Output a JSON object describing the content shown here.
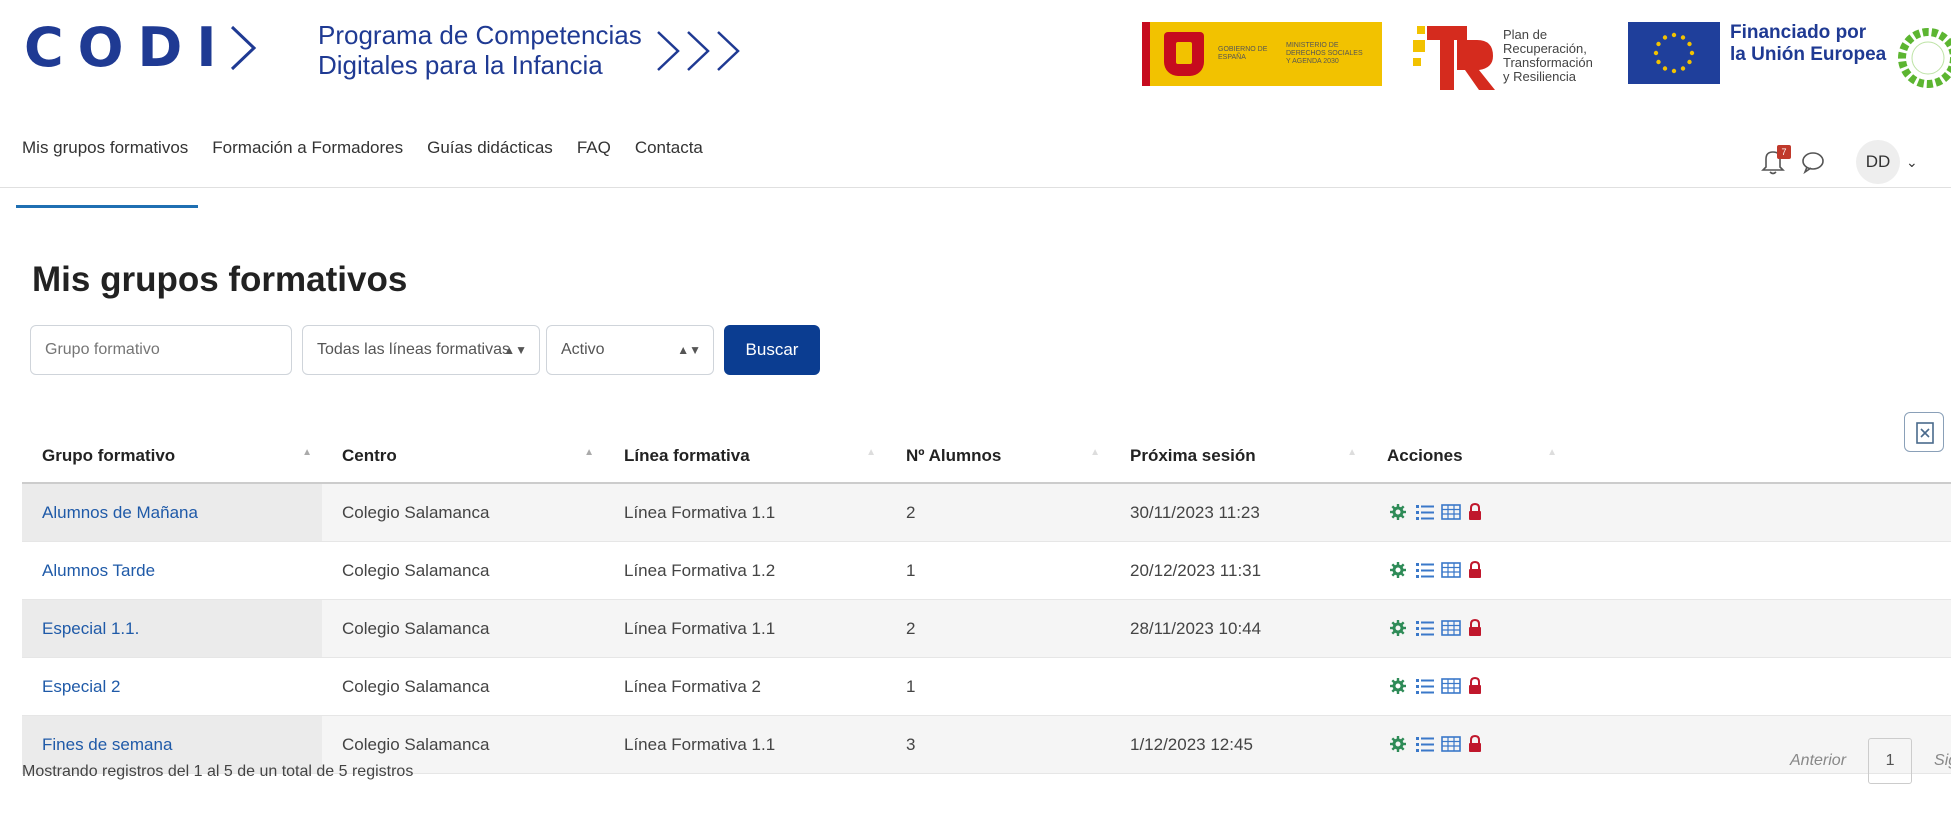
{
  "brand": {
    "codi_text": "CODI",
    "program_line1": "Programa de Competencias",
    "program_line2": "Digitales para la Infancia",
    "gov_text1": "GOBIERNO DE ESPAÑA",
    "gov_text2": "MINISTERIO DE DERECHOS SOCIALES Y AGENDA 2030",
    "tr_text": [
      "Plan de",
      "Recuperación,",
      "Transformación",
      "y Resiliencia"
    ],
    "eu_text": [
      "Financiado por",
      "la Unión Europea"
    ],
    "colors": {
      "primary": "#1f3a93",
      "gov_yellow": "#f2c200",
      "gov_red": "#c60b1e",
      "eu_blue": "#1f3f9b",
      "button": "#0b3d91",
      "link": "#1f5aa8"
    }
  },
  "nav": {
    "items": [
      {
        "label": "Mis grupos formativos",
        "active": true
      },
      {
        "label": "Formación a Formadores"
      },
      {
        "label": "Guías didácticas"
      },
      {
        "label": "FAQ"
      },
      {
        "label": "Contacta"
      }
    ],
    "notification_count": "7",
    "user_initials": "DD",
    "icons": [
      "bell-icon",
      "chat-icon",
      "chevron-down-icon"
    ]
  },
  "page": {
    "title": "Mis grupos formativos"
  },
  "filters": {
    "group_placeholder": "Grupo formativo",
    "line_select": "Todas las líneas formativas",
    "status_select": "Activo",
    "search_button": "Buscar"
  },
  "table": {
    "headers": [
      "Grupo formativo",
      "Centro",
      "Línea formativa",
      "Nº Alumnos",
      "Próxima sesión",
      "Acciones"
    ],
    "rows": [
      {
        "grupo": "Alumnos de Mañana",
        "centro": "Colegio Salamanca",
        "linea": "Línea Formativa 1.1",
        "alumnos": "2",
        "sesion": "30/11/2023 11:23"
      },
      {
        "grupo": "Alumnos Tarde",
        "centro": "Colegio Salamanca",
        "linea": "Línea Formativa 1.2",
        "alumnos": "1",
        "sesion": "20/12/2023 11:31"
      },
      {
        "grupo": "Especial 1.1.",
        "centro": "Colegio Salamanca",
        "linea": "Línea Formativa 1.1",
        "alumnos": "2",
        "sesion": "28/11/2023 10:44"
      },
      {
        "grupo": "Especial 2",
        "centro": "Colegio Salamanca",
        "linea": "Línea Formativa 2",
        "alumnos": "1",
        "sesion": ""
      },
      {
        "grupo": "Fines de semana",
        "centro": "Colegio Salamanca",
        "linea": "Línea Formativa 1.1",
        "alumnos": "3",
        "sesion": "1/12/2023 12:45"
      }
    ],
    "action_icons": [
      "gear-icon",
      "list-icon",
      "grid-icon",
      "lock-icon"
    ]
  },
  "footer": {
    "info": "Mostrando registros del 1 al 5 de un total de 5 registros",
    "prev": "Anterior",
    "current_page": "1",
    "next": "Siguiente"
  }
}
